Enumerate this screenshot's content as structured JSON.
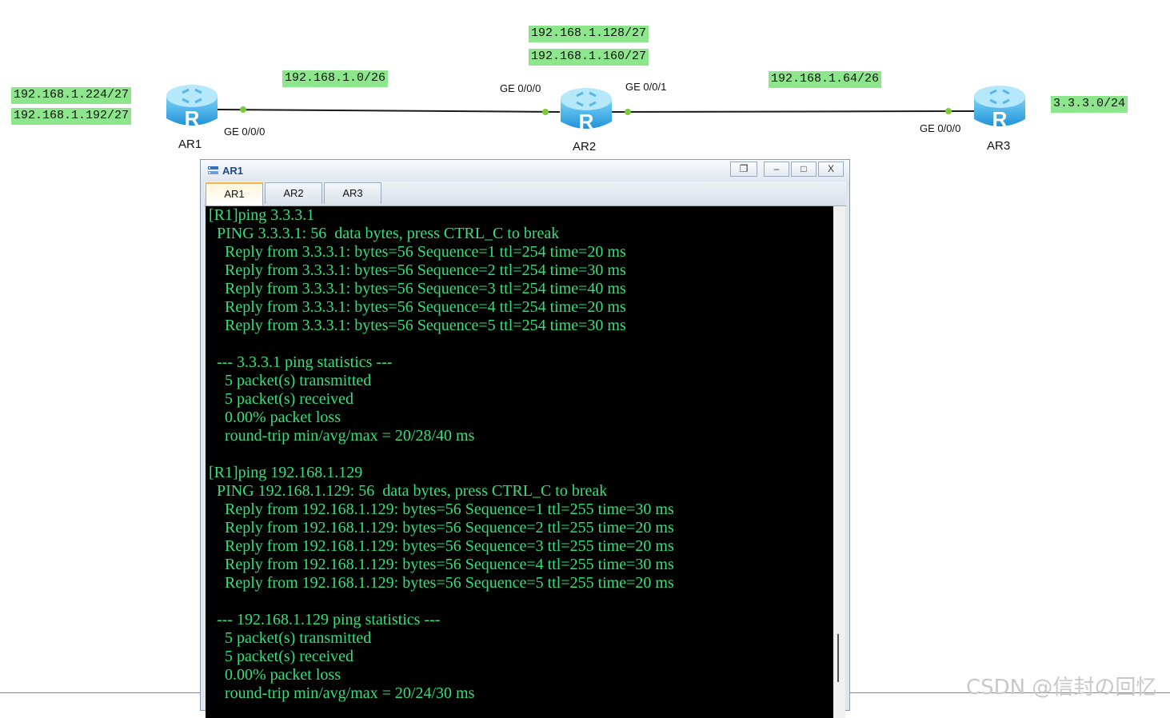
{
  "topology": {
    "routers": [
      {
        "name": "AR1",
        "letter": "R"
      },
      {
        "name": "AR2",
        "letter": "R"
      },
      {
        "name": "AR3",
        "letter": "R"
      }
    ],
    "networks": {
      "ar1_a": "192.168.1.224/27",
      "ar1_b": "192.168.1.192/27",
      "link1": "192.168.1.0/26",
      "ar2_a": "192.168.1.128/27",
      "ar2_b": "192.168.1.160/27",
      "link2": "192.168.1.64/26",
      "ar3": "3.3.3.0/24"
    },
    "ports": {
      "ar1_ge000": "GE 0/0/0",
      "ar2_ge000": "GE 0/0/0",
      "ar2_ge001": "GE 0/0/1",
      "ar3_ge000": "GE 0/0/0"
    },
    "colors": {
      "label_bg": "#8ee68c",
      "link": "#1a1a1a",
      "port_dot": "#7ccc3a"
    }
  },
  "window": {
    "title": "AR1",
    "controls": {
      "restore": "❐",
      "minimize": "–",
      "maximize": "□",
      "close": "X"
    },
    "tabs": [
      {
        "label": "AR1",
        "active": true
      },
      {
        "label": "AR2",
        "active": false
      },
      {
        "label": "AR3",
        "active": false
      }
    ],
    "terminal_lines": [
      "[R1]ping 3.3.3.1",
      "  PING 3.3.3.1: 56  data bytes, press CTRL_C to break",
      "    Reply from 3.3.3.1: bytes=56 Sequence=1 ttl=254 time=20 ms",
      "    Reply from 3.3.3.1: bytes=56 Sequence=2 ttl=254 time=30 ms",
      "    Reply from 3.3.3.1: bytes=56 Sequence=3 ttl=254 time=40 ms",
      "    Reply from 3.3.3.1: bytes=56 Sequence=4 ttl=254 time=20 ms",
      "    Reply from 3.3.3.1: bytes=56 Sequence=5 ttl=254 time=30 ms",
      "",
      "  --- 3.3.3.1 ping statistics ---",
      "    5 packet(s) transmitted",
      "    5 packet(s) received",
      "    0.00% packet loss",
      "    round-trip min/avg/max = 20/28/40 ms",
      "",
      "[R1]ping 192.168.1.129",
      "  PING 192.168.1.129: 56  data bytes, press CTRL_C to break",
      "    Reply from 192.168.1.129: bytes=56 Sequence=1 ttl=255 time=30 ms",
      "    Reply from 192.168.1.129: bytes=56 Sequence=2 ttl=255 time=20 ms",
      "    Reply from 192.168.1.129: bytes=56 Sequence=3 ttl=255 time=20 ms",
      "    Reply from 192.168.1.129: bytes=56 Sequence=4 ttl=255 time=30 ms",
      "    Reply from 192.168.1.129: bytes=56 Sequence=5 ttl=255 time=20 ms",
      "",
      "  --- 192.168.1.129 ping statistics ---",
      "    5 packet(s) transmitted",
      "    5 packet(s) received",
      "    0.00% packet loss",
      "    round-trip min/avg/max = 20/24/30 ms"
    ],
    "terminal_colors": {
      "bg": "#000000",
      "fg": "#33e07a"
    }
  },
  "watermark": "CSDN @信封の回忆"
}
